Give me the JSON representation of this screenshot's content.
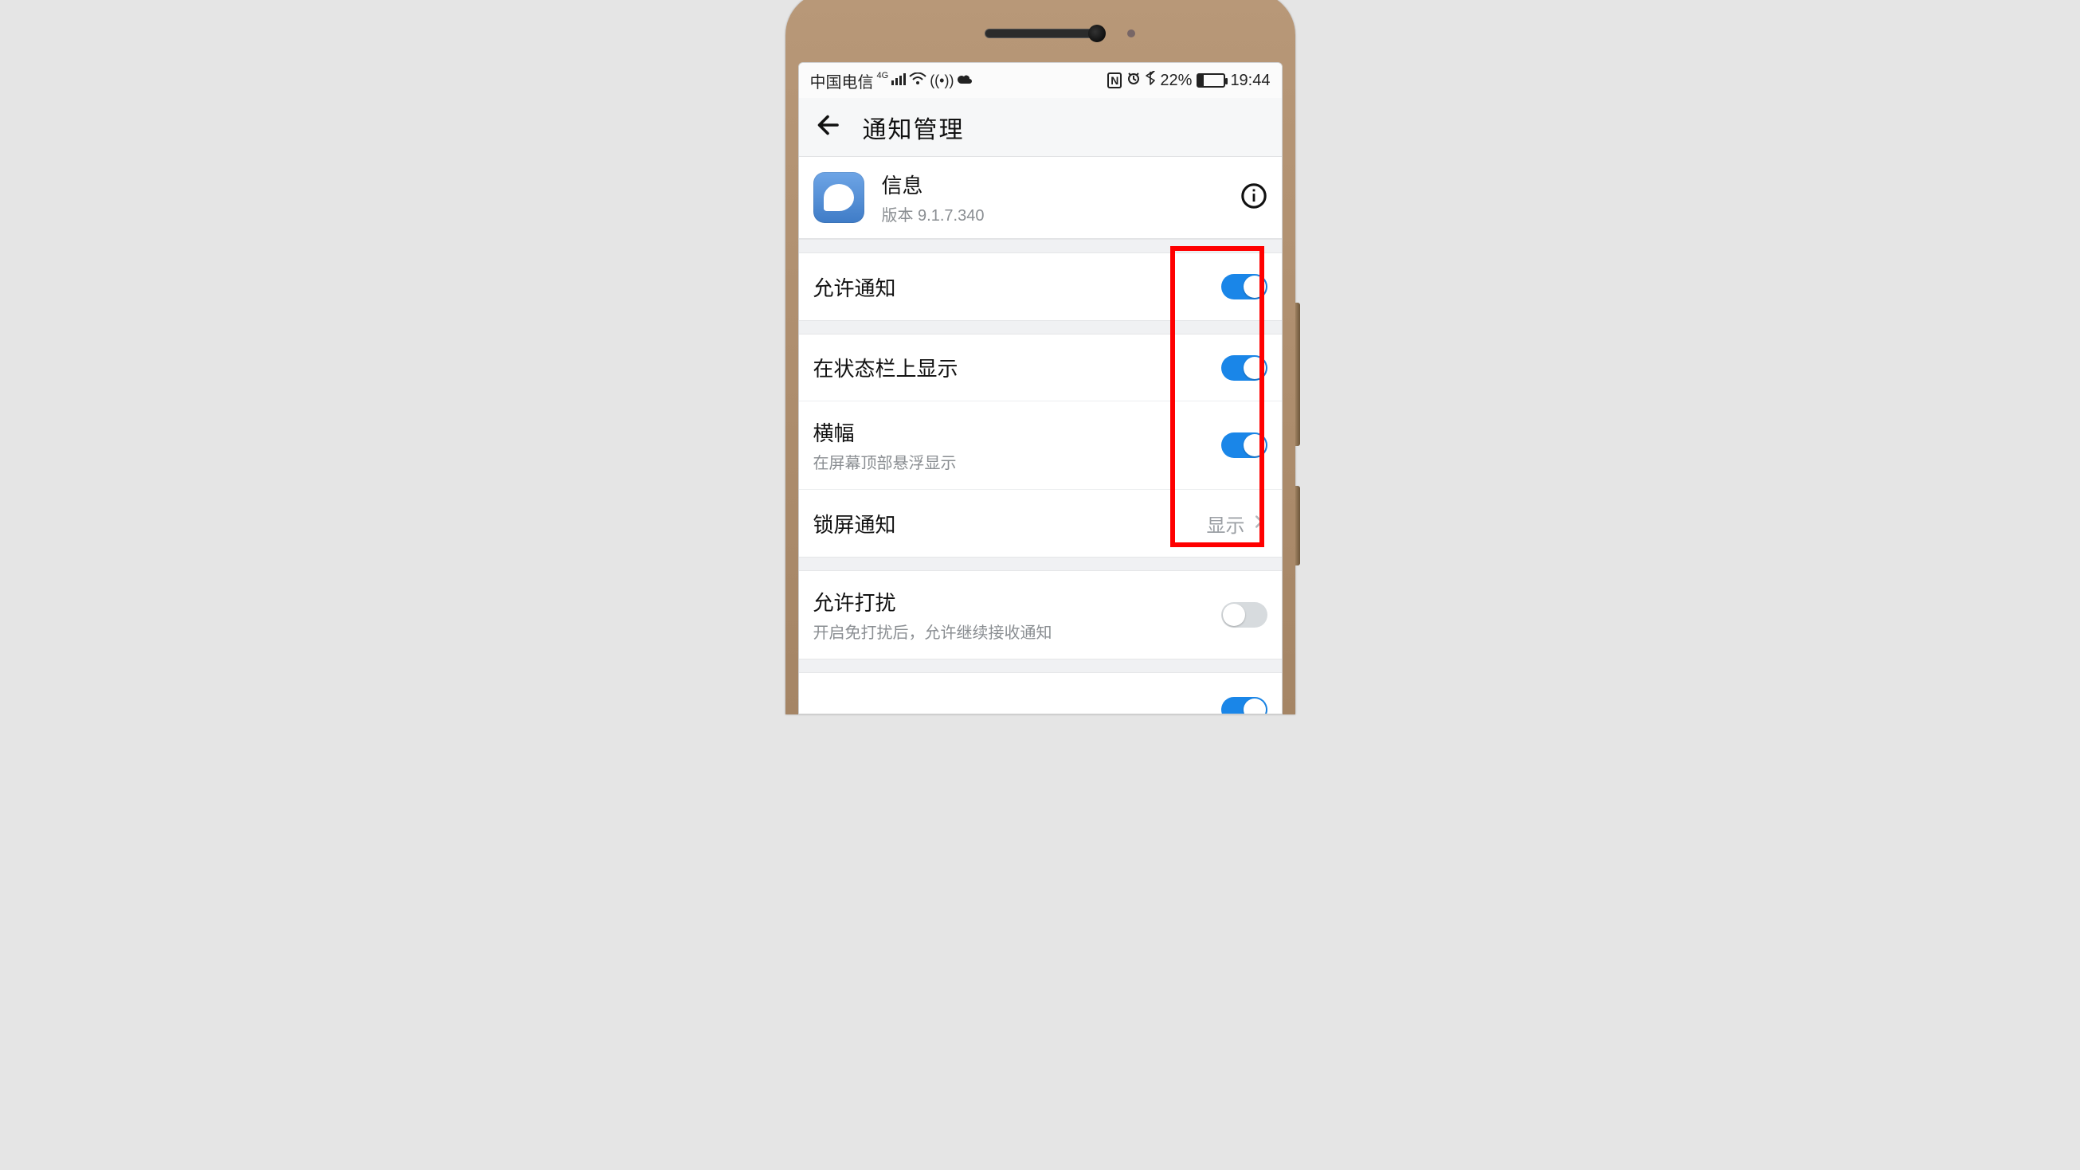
{
  "statusbar": {
    "carrier": "中国电信",
    "net_badge": "4G",
    "batt_text": "22%",
    "time": "19:44"
  },
  "appbar": {
    "title": "通知管理"
  },
  "app": {
    "name": "信息",
    "version": "版本 9.1.7.340"
  },
  "rows": {
    "allow_notify": {
      "label": "允许通知",
      "on": true
    },
    "status_bar": {
      "label": "在状态栏上显示",
      "on": true
    },
    "banner": {
      "label": "横幅",
      "sub": "在屏幕顶部悬浮显示",
      "on": true
    },
    "lockscreen": {
      "label": "锁屏通知",
      "value": "显示"
    },
    "allow_disturb": {
      "label": "允许打扰",
      "sub": "开启免打扰后，允许继续接收通知",
      "on": false
    }
  }
}
